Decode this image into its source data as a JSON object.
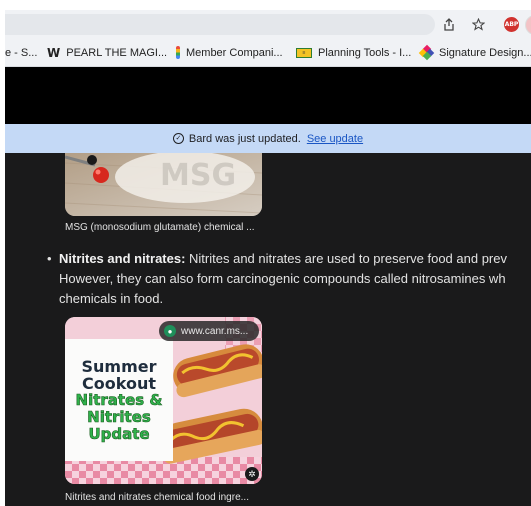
{
  "browser": {
    "icons": [
      "share-icon",
      "star-icon",
      "adblock-icon",
      "profile-avatar"
    ],
    "adblock_label": "ABP"
  },
  "bookmarks": [
    {
      "label": "e - S...",
      "icon": "none"
    },
    {
      "label": "PEARL THE MAGI...",
      "icon": "w-logo-icon",
      "icon_text": "W"
    },
    {
      "label": "Member Compani...",
      "icon": "colorbar-icon"
    },
    {
      "label": "Planning Tools - I...",
      "icon": "plan-icon",
      "icon_text": "≡"
    },
    {
      "label": "Signature Design...",
      "icon": "diamond-icon"
    }
  ],
  "banner": {
    "text": "Bard was just updated.",
    "link": "See update",
    "color": "#c4d9f6"
  },
  "content": {
    "msg_caption": "MSG (monosodium glutamate) chemical ...",
    "nitrites": {
      "bold": "Nitrites and nitrates:",
      "line1": " Nitrites and nitrates are used to preserve food and prev",
      "line2": "However, they can also form carcinogenic compounds called nitrosamines wh",
      "line3": "chemicals in food."
    },
    "hotdog_image": {
      "url": "www.canr.ms...",
      "sign_lines": [
        "Summer",
        "Cookout",
        "Nitrates &",
        "Nitrites",
        "Update"
      ]
    },
    "hotdog_caption": "Nitrites and nitrates chemical food ingre..."
  }
}
